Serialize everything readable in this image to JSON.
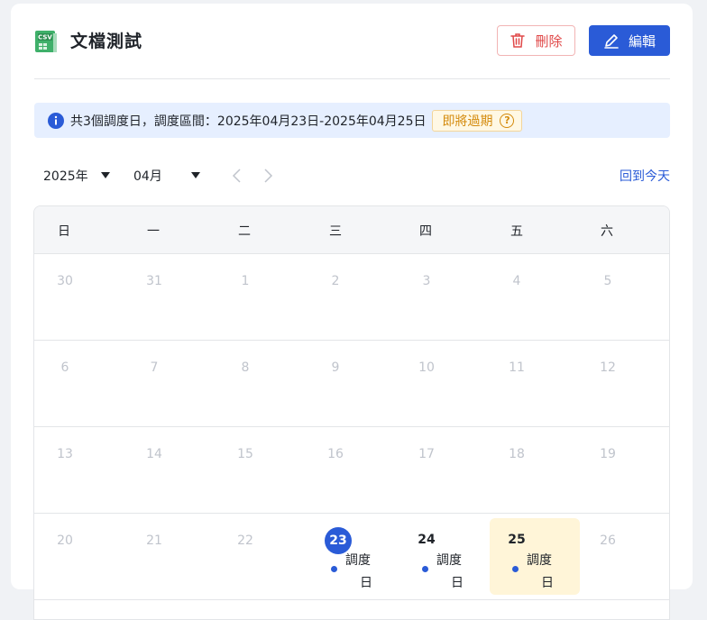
{
  "header": {
    "file_icon_label": "CSV",
    "title": "文檔測試",
    "delete_label": "刪除",
    "edit_label": "編輯"
  },
  "info": {
    "text": "共3個調度日，調度區間：2025年04月23日-2025年04月25日",
    "tag": "即將過期",
    "tag_help": "?"
  },
  "toolbar": {
    "year": "2025年",
    "month": "04月",
    "today_link": "回到今天"
  },
  "calendar": {
    "weekdays": [
      "日",
      "一",
      "二",
      "三",
      "四",
      "五",
      "六"
    ],
    "weeks": [
      [
        "30",
        "31",
        "1",
        "2",
        "3",
        "4",
        "5"
      ],
      [
        "6",
        "7",
        "8",
        "9",
        "10",
        "11",
        "12"
      ],
      [
        "13",
        "14",
        "15",
        "16",
        "17",
        "18",
        "19"
      ],
      [
        "20",
        "21",
        "22",
        "23",
        "24",
        "25",
        "26"
      ]
    ],
    "event_line1": "調度",
    "event_line2": "日"
  },
  "colors": {
    "primary": "#2a5bd7",
    "danger": "#e04848",
    "warning": "#d48a0c",
    "info_bg": "#e6efff",
    "highlight_bg": "#fff5d8"
  },
  "icons": {
    "file": "csv-file-icon",
    "delete": "trash-icon",
    "edit": "pencil-icon",
    "info": "info-icon",
    "help": "question-circle-icon",
    "prev": "chevron-left-icon",
    "next": "chevron-right-icon"
  }
}
